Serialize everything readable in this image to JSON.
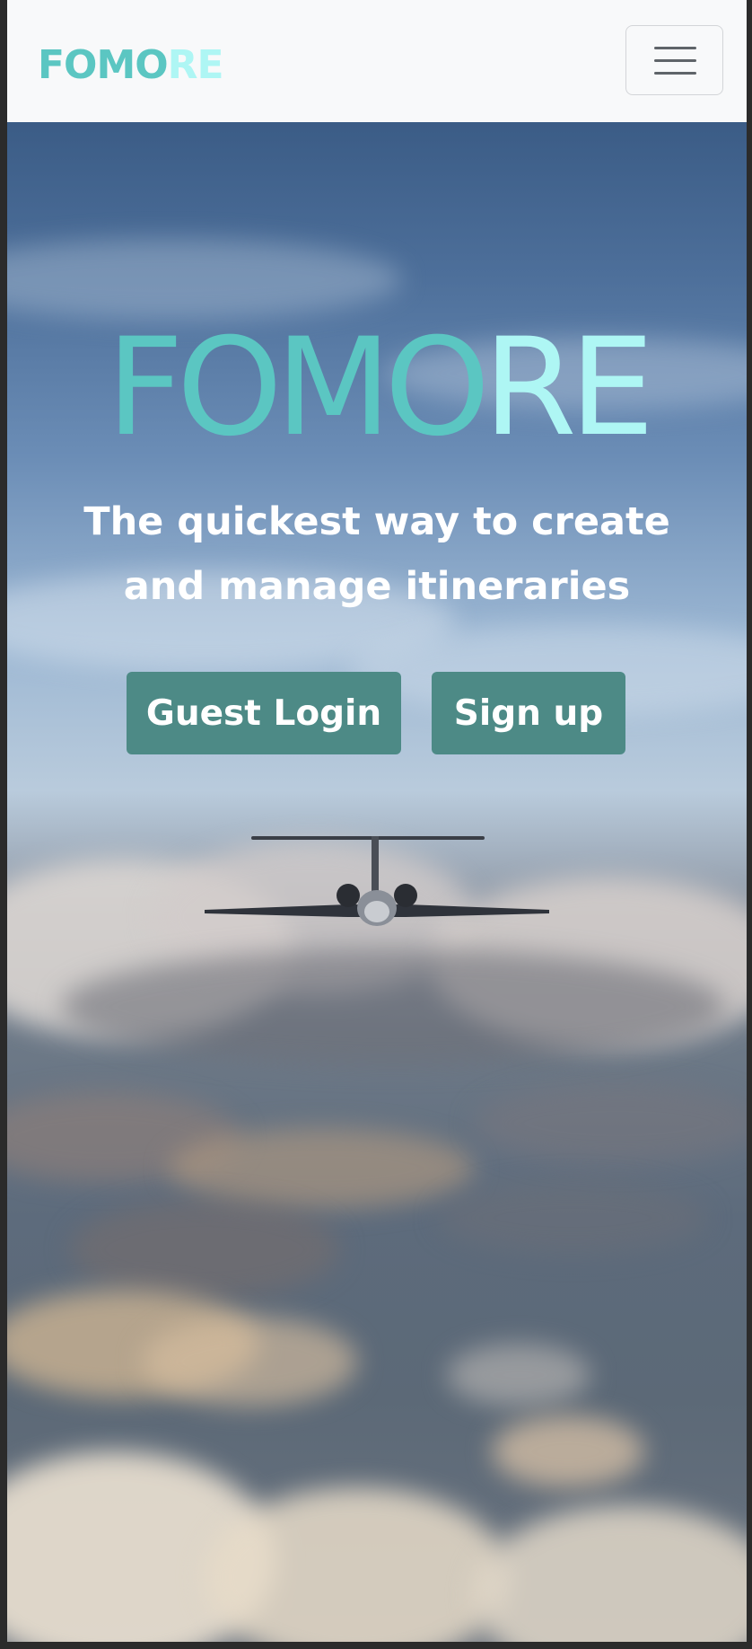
{
  "navbar": {
    "brand_part_a": "FOMO",
    "brand_part_b": "RE",
    "toggler_icon": "hamburger-menu-icon"
  },
  "hero": {
    "title_part_a": "FOMO",
    "title_part_b": "RE",
    "tagline": "The quickest way to create and manage itineraries",
    "guest_login_label": "Guest Login",
    "signup_label": "Sign up",
    "background_image": "airplane-above-clouds"
  },
  "colors": {
    "brand_teal": "#5bc6c2",
    "brand_light": "#aef6f4",
    "button_bg": "#4d8a86",
    "navbar_bg": "#f8f9fa"
  }
}
